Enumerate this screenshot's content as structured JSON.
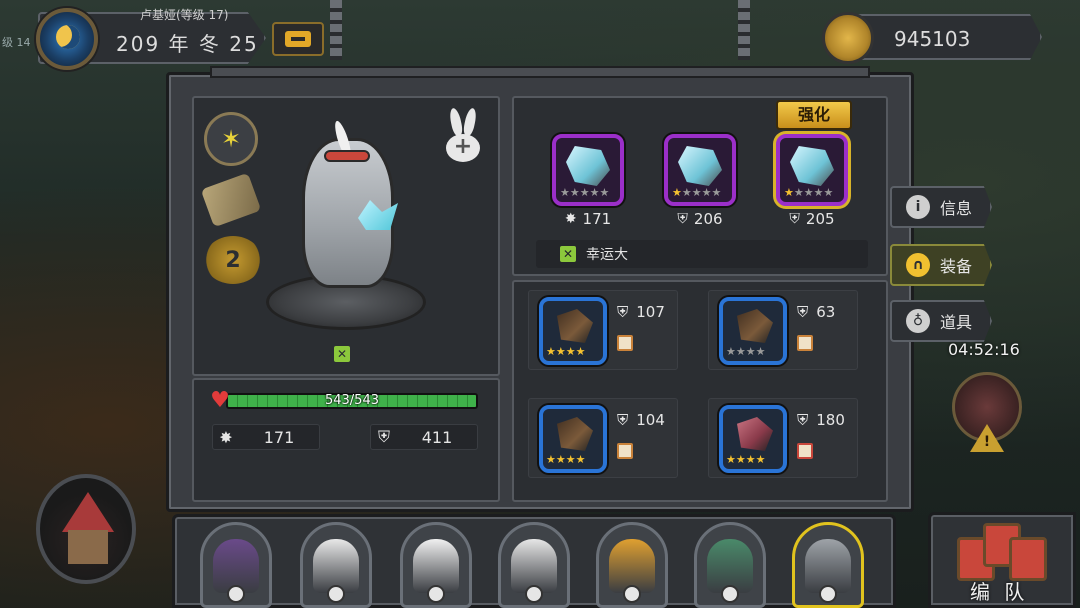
{
  "header": {
    "player_name": "卢基娅(等级 17)",
    "side_level": "级 14",
    "date": "209 年 冬 25",
    "gold": "945103"
  },
  "hero": {
    "rank": "2",
    "hp": {
      "current": 543,
      "max": 543,
      "text": "543/543"
    },
    "attack": "171",
    "defense": "411"
  },
  "equipment": {
    "enhance_label": "强化",
    "slots": [
      {
        "stat_icon": "attack-icon",
        "value": "171",
        "stars_lit": 0,
        "stars_total": 5,
        "rarity_color": "#9b2fc9"
      },
      {
        "stat_icon": "defense-icon",
        "value": "206",
        "stars_lit": 1,
        "stars_total": 5,
        "rarity_color": "#9b2fc9"
      },
      {
        "stat_icon": "defense-icon",
        "value": "205",
        "stars_lit": 1,
        "stars_total": 5,
        "rarity_color": "#9b2fc9",
        "selected": true
      }
    ],
    "trait_label": "幸运大"
  },
  "items": [
    {
      "value": "107",
      "stars_lit": 4,
      "stars_total": 4,
      "rarity_color": "#2a74d6",
      "type_color": "#c9823a"
    },
    {
      "value": "63",
      "stars_lit": 0,
      "stars_total": 4,
      "rarity_color": "#2a74d6",
      "type_color": "#c9823a"
    },
    {
      "value": "104",
      "stars_lit": 4,
      "stars_total": 4,
      "rarity_color": "#2a74d6",
      "type_color": "#c9823a"
    },
    {
      "value": "180",
      "stars_lit": 4,
      "stars_total": 4,
      "rarity_color": "#2a74d6",
      "type_color": "#c9473b"
    }
  ],
  "side_tabs": [
    {
      "label": "信息",
      "icon": "info-icon",
      "active": false
    },
    {
      "label": "装备",
      "icon": "helmet-icon",
      "active": true
    },
    {
      "label": "道具",
      "icon": "pouch-icon",
      "active": false
    }
  ],
  "timer": "04:52:16",
  "roster": [
    {
      "name": "pirate-wolf",
      "color": "#6a4a8a"
    },
    {
      "name": "eagle",
      "color": "#e8e8e8"
    },
    {
      "name": "white-goat",
      "color": "#f0f0f0"
    },
    {
      "name": "polar-bear",
      "color": "#e6e6e6"
    },
    {
      "name": "leopard",
      "color": "#e0a030"
    },
    {
      "name": "crocodile",
      "color": "#4a8a6a"
    },
    {
      "name": "elephant",
      "color": "#9ea3a8",
      "selected": true
    }
  ],
  "formation_label": "编 队",
  "colors": {
    "epic": "#9b2fc9",
    "rare": "#2a74d6",
    "selected": "#e1c31e",
    "hp_green": "#3fb14a"
  }
}
